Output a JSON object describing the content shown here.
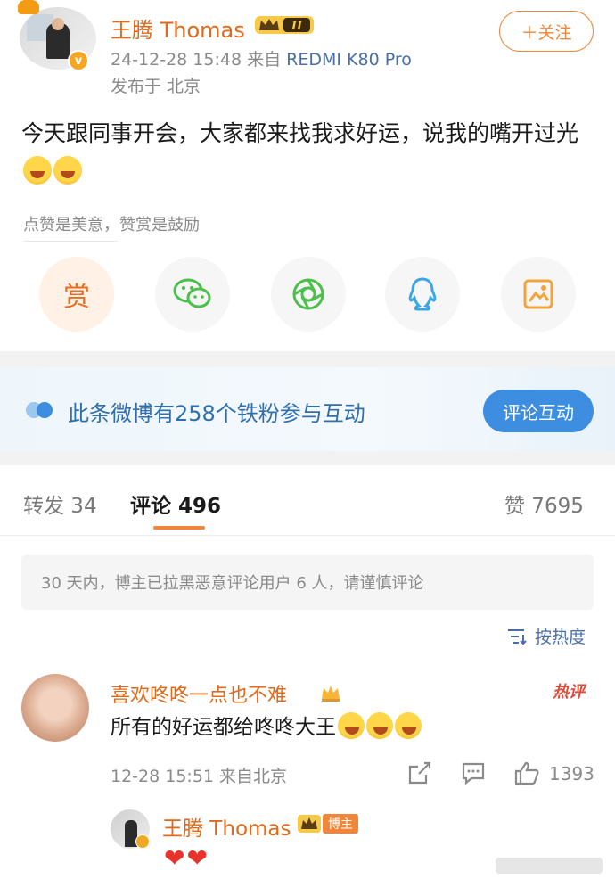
{
  "post": {
    "author": "王腾 Thomas",
    "member_level": "II",
    "date": "24-12-28 15:48",
    "from_label": "来自",
    "device": "REDMI K80 Pro",
    "location": "发布于 北京",
    "follow_label": "＋关注",
    "text": "今天跟同事开会，大家都来找我求好运，说我的嘴开过光",
    "reward_hint": "点赞是美意，赞赏是鼓励",
    "reward_label": "赏"
  },
  "share_icons": [
    "reward-icon",
    "wechat-icon",
    "moments-icon",
    "qq-icon",
    "save-image-icon"
  ],
  "banner": {
    "text": "此条微博有258个铁粉参与互动",
    "button": "评论互动"
  },
  "tabs": {
    "repost": "转发 34",
    "comments": "评论 496",
    "likes": "赞 7695"
  },
  "notice": "30 天内，博主已拉黑恶意评论用户 6 人，请谨慎评论",
  "sort_label": "按热度",
  "comment": {
    "author": "喜欢咚咚一点也不难",
    "hot_tag": "热评",
    "text": "所有的好运都给咚咚大王",
    "meta": "12-28 15:51 来自北京",
    "likes": "1393"
  },
  "reply": {
    "author": "王腾 Thomas",
    "tag": "博主",
    "text": "❤❤"
  },
  "colors": {
    "accent_orange": "#f0863a",
    "name_orange": "#e06a1b",
    "link_blue": "#4a6ea8",
    "banner_blue": "#3d8ee0"
  }
}
